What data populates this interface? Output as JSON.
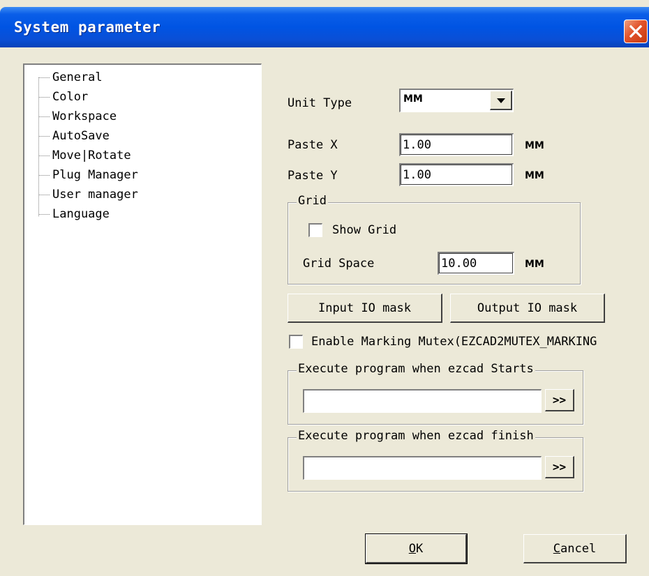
{
  "window": {
    "title": "System parameter"
  },
  "tree": {
    "items": [
      "General",
      "Color",
      "Workspace",
      "AutoSave",
      "Move|Rotate",
      "Plug Manager",
      "User manager",
      "Language"
    ]
  },
  "form": {
    "unit_type_label": "Unit Type",
    "unit_type_value": "MM",
    "paste_x_label": "Paste X",
    "paste_x_value": "1.00",
    "paste_x_unit": "MM",
    "paste_y_label": "Paste Y",
    "paste_y_value": "1.00",
    "paste_y_unit": "MM",
    "grid": {
      "legend": "Grid",
      "show_grid_label": "Show Grid",
      "show_grid_checked": false,
      "grid_space_label": "Grid Space",
      "grid_space_value": "10.00",
      "grid_space_unit": "MM"
    },
    "input_io_mask_label": "Input IO mask",
    "output_io_mask_label": "Output IO mask",
    "enable_mutex_label": "Enable Marking Mutex(EZCAD2MUTEX_MARKING",
    "enable_mutex_checked": false,
    "exec_start": {
      "legend": "Execute program when ezcad Starts",
      "value": "",
      "browse_label": ">>"
    },
    "exec_finish": {
      "legend": "Execute program when ezcad finish",
      "value": "",
      "browse_label": ">>"
    }
  },
  "buttons": {
    "ok_mnemonic": "O",
    "ok_rest": "K",
    "cancel_mnemonic": "C",
    "cancel_rest": "ancel"
  },
  "icons": {
    "close": "close-icon",
    "dropdown": "chevron-down-icon"
  },
  "colors": {
    "titlebar": "#0054e3",
    "close_button": "#e2522a",
    "dialog_bg": "#ece9d8"
  }
}
